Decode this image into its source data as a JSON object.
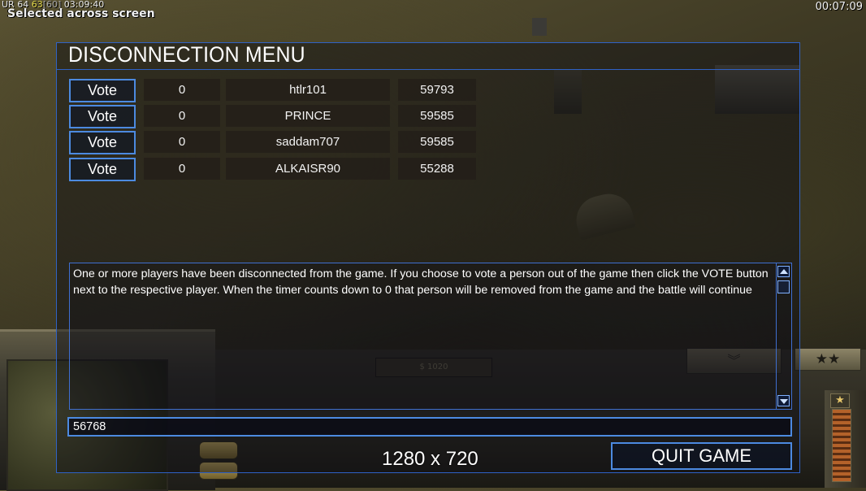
{
  "overlay": {
    "fps_prefix": "UR 64",
    "fps_value": "63",
    "fps_bracket": "[60]",
    "clock": "03:09:40",
    "selected_message": "Selected across screen",
    "game_timer": "00:07:09"
  },
  "hud": {
    "money": "$ 1020",
    "rank_stars": "★★",
    "rank_chevron": "︾",
    "power_icon": "★"
  },
  "dialog": {
    "title": "DISCONNECTION MENU",
    "players": [
      {
        "vote_label": "Vote",
        "count": "0",
        "name": "htlr101",
        "ping": "59793"
      },
      {
        "vote_label": "Vote",
        "count": "0",
        "name": "PRINCE",
        "ping": "59585"
      },
      {
        "vote_label": "Vote",
        "count": "0",
        "name": "saddam707",
        "ping": "59585"
      },
      {
        "vote_label": "Vote",
        "count": "0",
        "name": "ALKAISR90",
        "ping": "55288"
      }
    ],
    "message": "One or more players have been disconnected from the game. If you choose to vote a person out of the game then click the VOTE button next to the respective player. When the timer counts down to 0 that person will be removed from the game and the battle will continue",
    "input_value": "56768",
    "quit_label": "QUIT GAME"
  },
  "resolution_label": "1280 x 720",
  "colors": {
    "accent": "#4c8ae0",
    "border": "#2f62c6"
  }
}
